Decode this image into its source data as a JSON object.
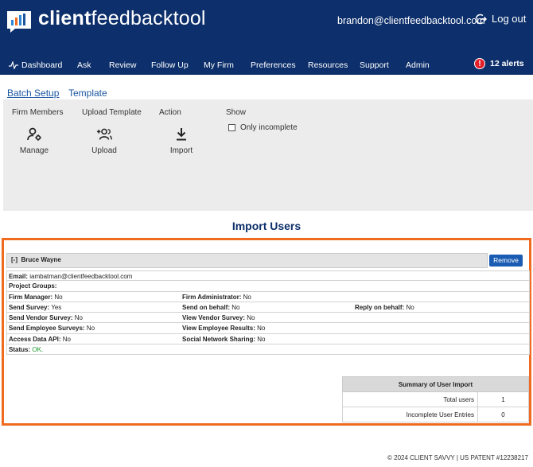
{
  "header": {
    "brand_bold": "client",
    "brand_rest": "feedbacktool",
    "user_email": "brandon@clientfeedbacktool.com",
    "logout_label": "Log out"
  },
  "nav": {
    "items": [
      {
        "label": "Dashboard",
        "icon": "pulse-icon"
      },
      {
        "label": "Ask"
      },
      {
        "label": "Review"
      },
      {
        "label": "Follow Up"
      },
      {
        "label": "My Firm"
      },
      {
        "label": "Preferences"
      },
      {
        "label": "Resources"
      },
      {
        "label": "Support"
      },
      {
        "label": "Admin"
      }
    ],
    "alerts_label": "12 alerts",
    "alerts_icon_text": "!"
  },
  "tabs": [
    {
      "label": "Batch Setup",
      "active": true
    },
    {
      "label": "Template",
      "active": false
    }
  ],
  "tools": {
    "headings": [
      "Firm Members",
      "Upload Template",
      "Action",
      "Show"
    ],
    "actions": [
      {
        "label": "Manage",
        "icon": "user-gear-icon"
      },
      {
        "label": "Upload",
        "icon": "add-users-icon"
      },
      {
        "label": "Import",
        "icon": "download-icon"
      }
    ],
    "checkbox_label": "Only incomplete"
  },
  "import": {
    "title": "Import Users",
    "user_name": "Bruce Wayne",
    "toggle": "[-]",
    "remove_label": "Remove",
    "rows": [
      [
        {
          "k": "Email:",
          "v": "iambatman@clientfeedbacktool.com"
        }
      ],
      [
        {
          "k": "Project Groups:",
          "v": ""
        }
      ],
      [
        {
          "k": "Firm Manager:",
          "v": "No"
        },
        {
          "k": "Firm Administrator:",
          "v": "No"
        }
      ],
      [
        {
          "k": "Send Survey:",
          "v": "Yes"
        },
        {
          "k": "Send on behalf:",
          "v": "No"
        },
        {
          "k": "Reply on behalf:",
          "v": "No"
        }
      ],
      [
        {
          "k": "Send Vendor Survey:",
          "v": "No"
        },
        {
          "k": "View Vendor Survey:",
          "v": "No"
        }
      ],
      [
        {
          "k": "Send Employee Surveys:",
          "v": "No"
        },
        {
          "k": "View Employee Results:",
          "v": "No"
        }
      ],
      [
        {
          "k": "Access Data API:",
          "v": "No"
        },
        {
          "k": "Social Network Sharing:",
          "v": "No"
        }
      ],
      [
        {
          "k": "Status:",
          "v": "OK."
        }
      ]
    ],
    "summary": {
      "title": "Summary of User Import",
      "rows": [
        {
          "label": "Total users",
          "value": "1"
        },
        {
          "label": "Incomplete User Entries",
          "value": "0"
        }
      ]
    }
  },
  "footer": "© 2024 CLIENT SAVVY | US PATENT #12238217",
  "colors": {
    "nav_bg": "#0d2f6b",
    "accent": "#1a5cb3",
    "highlight_border": "#f06a1f",
    "alert": "#e3202a",
    "ok": "#1c9a2b"
  }
}
